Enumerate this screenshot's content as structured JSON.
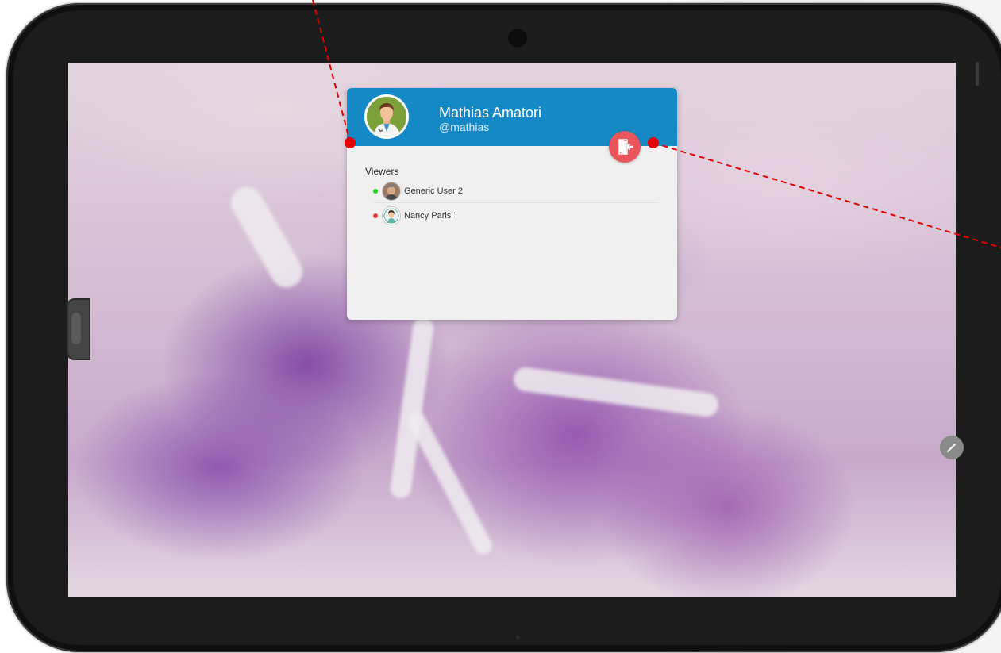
{
  "profile": {
    "name": "Mathias Amatori",
    "handle": "@mathias"
  },
  "viewers": {
    "title": "Viewers",
    "items": [
      {
        "name": "Generic User 2",
        "status": "online",
        "status_color": "#22cc22"
      },
      {
        "name": "Nancy Parisi",
        "status": "offline",
        "status_color": "#e53e3e"
      }
    ]
  },
  "icons": {
    "logout": "logout-door-icon",
    "edit": "pencil-icon"
  },
  "colors": {
    "header": "#1589c5",
    "logout_button": "#e8565c",
    "annotation": "#e60000"
  }
}
